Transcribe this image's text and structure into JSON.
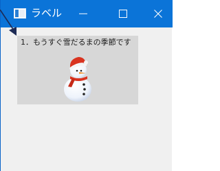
{
  "window": {
    "title": "ラベル",
    "icon": "window-app-icon",
    "controls": [
      "minimize-icon",
      "maximize-icon",
      "close-icon"
    ]
  },
  "label": {
    "text": "1．もうすぐ雪だるまの季節です",
    "image": "snowman-icon"
  },
  "colors": {
    "titlebar": "#0b74d8",
    "client_background": "#f0f0f0",
    "label_background": "#d7d7d7"
  }
}
